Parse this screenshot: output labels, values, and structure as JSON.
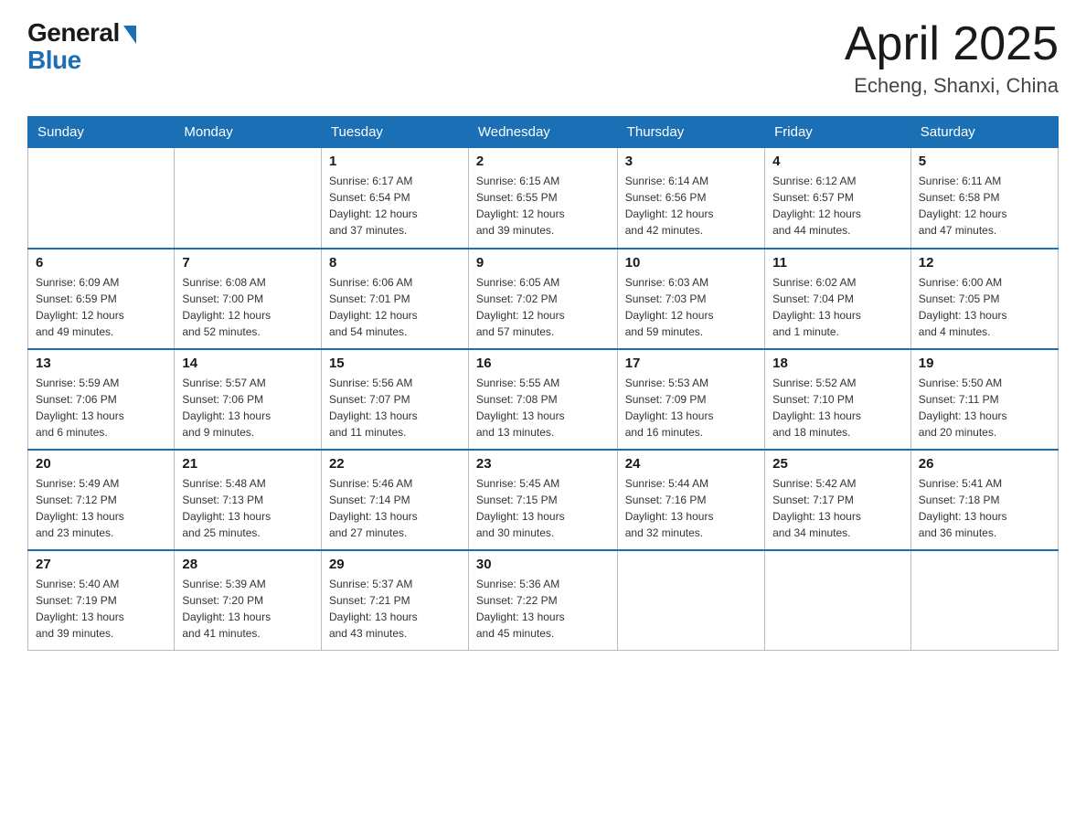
{
  "header": {
    "logo": {
      "general": "General",
      "blue": "Blue"
    },
    "title": "April 2025",
    "location": "Echeng, Shanxi, China"
  },
  "weekdays": [
    "Sunday",
    "Monday",
    "Tuesday",
    "Wednesday",
    "Thursday",
    "Friday",
    "Saturday"
  ],
  "weeks": [
    [
      {
        "day": "",
        "info": ""
      },
      {
        "day": "",
        "info": ""
      },
      {
        "day": "1",
        "info": "Sunrise: 6:17 AM\nSunset: 6:54 PM\nDaylight: 12 hours\nand 37 minutes."
      },
      {
        "day": "2",
        "info": "Sunrise: 6:15 AM\nSunset: 6:55 PM\nDaylight: 12 hours\nand 39 minutes."
      },
      {
        "day": "3",
        "info": "Sunrise: 6:14 AM\nSunset: 6:56 PM\nDaylight: 12 hours\nand 42 minutes."
      },
      {
        "day": "4",
        "info": "Sunrise: 6:12 AM\nSunset: 6:57 PM\nDaylight: 12 hours\nand 44 minutes."
      },
      {
        "day": "5",
        "info": "Sunrise: 6:11 AM\nSunset: 6:58 PM\nDaylight: 12 hours\nand 47 minutes."
      }
    ],
    [
      {
        "day": "6",
        "info": "Sunrise: 6:09 AM\nSunset: 6:59 PM\nDaylight: 12 hours\nand 49 minutes."
      },
      {
        "day": "7",
        "info": "Sunrise: 6:08 AM\nSunset: 7:00 PM\nDaylight: 12 hours\nand 52 minutes."
      },
      {
        "day": "8",
        "info": "Sunrise: 6:06 AM\nSunset: 7:01 PM\nDaylight: 12 hours\nand 54 minutes."
      },
      {
        "day": "9",
        "info": "Sunrise: 6:05 AM\nSunset: 7:02 PM\nDaylight: 12 hours\nand 57 minutes."
      },
      {
        "day": "10",
        "info": "Sunrise: 6:03 AM\nSunset: 7:03 PM\nDaylight: 12 hours\nand 59 minutes."
      },
      {
        "day": "11",
        "info": "Sunrise: 6:02 AM\nSunset: 7:04 PM\nDaylight: 13 hours\nand 1 minute."
      },
      {
        "day": "12",
        "info": "Sunrise: 6:00 AM\nSunset: 7:05 PM\nDaylight: 13 hours\nand 4 minutes."
      }
    ],
    [
      {
        "day": "13",
        "info": "Sunrise: 5:59 AM\nSunset: 7:06 PM\nDaylight: 13 hours\nand 6 minutes."
      },
      {
        "day": "14",
        "info": "Sunrise: 5:57 AM\nSunset: 7:06 PM\nDaylight: 13 hours\nand 9 minutes."
      },
      {
        "day": "15",
        "info": "Sunrise: 5:56 AM\nSunset: 7:07 PM\nDaylight: 13 hours\nand 11 minutes."
      },
      {
        "day": "16",
        "info": "Sunrise: 5:55 AM\nSunset: 7:08 PM\nDaylight: 13 hours\nand 13 minutes."
      },
      {
        "day": "17",
        "info": "Sunrise: 5:53 AM\nSunset: 7:09 PM\nDaylight: 13 hours\nand 16 minutes."
      },
      {
        "day": "18",
        "info": "Sunrise: 5:52 AM\nSunset: 7:10 PM\nDaylight: 13 hours\nand 18 minutes."
      },
      {
        "day": "19",
        "info": "Sunrise: 5:50 AM\nSunset: 7:11 PM\nDaylight: 13 hours\nand 20 minutes."
      }
    ],
    [
      {
        "day": "20",
        "info": "Sunrise: 5:49 AM\nSunset: 7:12 PM\nDaylight: 13 hours\nand 23 minutes."
      },
      {
        "day": "21",
        "info": "Sunrise: 5:48 AM\nSunset: 7:13 PM\nDaylight: 13 hours\nand 25 minutes."
      },
      {
        "day": "22",
        "info": "Sunrise: 5:46 AM\nSunset: 7:14 PM\nDaylight: 13 hours\nand 27 minutes."
      },
      {
        "day": "23",
        "info": "Sunrise: 5:45 AM\nSunset: 7:15 PM\nDaylight: 13 hours\nand 30 minutes."
      },
      {
        "day": "24",
        "info": "Sunrise: 5:44 AM\nSunset: 7:16 PM\nDaylight: 13 hours\nand 32 minutes."
      },
      {
        "day": "25",
        "info": "Sunrise: 5:42 AM\nSunset: 7:17 PM\nDaylight: 13 hours\nand 34 minutes."
      },
      {
        "day": "26",
        "info": "Sunrise: 5:41 AM\nSunset: 7:18 PM\nDaylight: 13 hours\nand 36 minutes."
      }
    ],
    [
      {
        "day": "27",
        "info": "Sunrise: 5:40 AM\nSunset: 7:19 PM\nDaylight: 13 hours\nand 39 minutes."
      },
      {
        "day": "28",
        "info": "Sunrise: 5:39 AM\nSunset: 7:20 PM\nDaylight: 13 hours\nand 41 minutes."
      },
      {
        "day": "29",
        "info": "Sunrise: 5:37 AM\nSunset: 7:21 PM\nDaylight: 13 hours\nand 43 minutes."
      },
      {
        "day": "30",
        "info": "Sunrise: 5:36 AM\nSunset: 7:22 PM\nDaylight: 13 hours\nand 45 minutes."
      },
      {
        "day": "",
        "info": ""
      },
      {
        "day": "",
        "info": ""
      },
      {
        "day": "",
        "info": ""
      }
    ]
  ]
}
